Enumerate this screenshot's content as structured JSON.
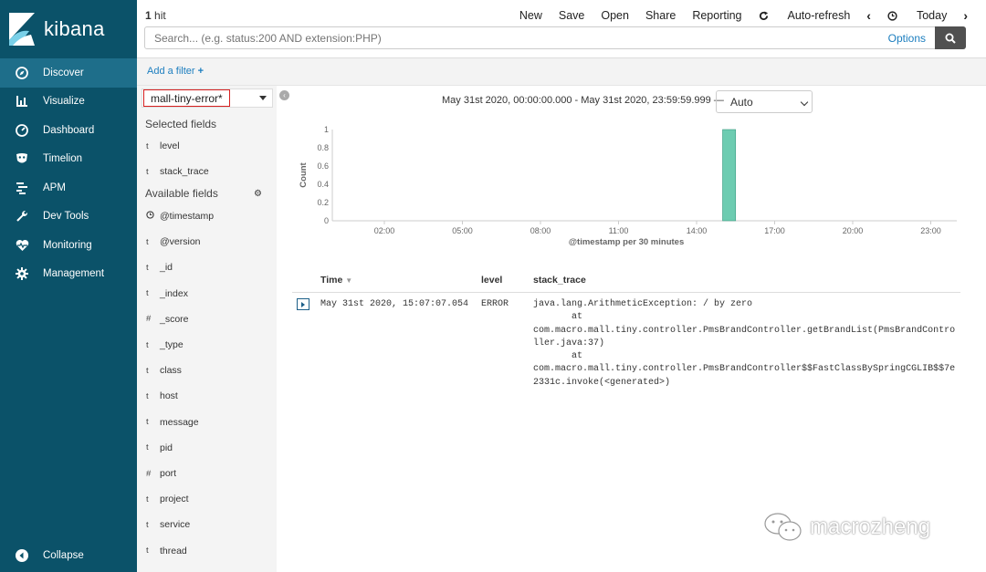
{
  "app": {
    "name": "kibana"
  },
  "sidebar": {
    "items": [
      {
        "label": "Discover",
        "icon": "compass-icon",
        "active": true
      },
      {
        "label": "Visualize",
        "icon": "bar-chart-icon"
      },
      {
        "label": "Dashboard",
        "icon": "dashboard-gauge-icon"
      },
      {
        "label": "Timelion",
        "icon": "timelion-mask-icon"
      },
      {
        "label": "APM",
        "icon": "apm-bars-icon"
      },
      {
        "label": "Dev Tools",
        "icon": "wrench-icon"
      },
      {
        "label": "Monitoring",
        "icon": "heartbeat-icon"
      },
      {
        "label": "Management",
        "icon": "gear-icon"
      }
    ],
    "collapse_label": "Collapse"
  },
  "topbar": {
    "hit_count": "1",
    "hit_label": "hit",
    "menu": {
      "new": "New",
      "save": "Save",
      "open": "Open",
      "share": "Share",
      "reporting": "Reporting",
      "auto_refresh": "Auto-refresh",
      "today": "Today"
    },
    "search_placeholder": "Search... (e.g. status:200 AND extension:PHP)",
    "options_label": "Options"
  },
  "filterbar": {
    "add_filter": "Add a filter"
  },
  "fields": {
    "index_pattern": "mall-tiny-error*",
    "selected_title": "Selected fields",
    "selected": [
      {
        "type": "t",
        "name": "level"
      },
      {
        "type": "t",
        "name": "stack_trace"
      }
    ],
    "available_title": "Available fields",
    "available": [
      {
        "type": "clock",
        "name": "@timestamp"
      },
      {
        "type": "t",
        "name": "@version"
      },
      {
        "type": "t",
        "name": "_id"
      },
      {
        "type": "t",
        "name": "_index"
      },
      {
        "type": "#",
        "name": "_score"
      },
      {
        "type": "t",
        "name": "_type"
      },
      {
        "type": "t",
        "name": "class"
      },
      {
        "type": "t",
        "name": "host"
      },
      {
        "type": "t",
        "name": "message"
      },
      {
        "type": "t",
        "name": "pid"
      },
      {
        "type": "#",
        "name": "port"
      },
      {
        "type": "t",
        "name": "project"
      },
      {
        "type": "t",
        "name": "service"
      },
      {
        "type": "t",
        "name": "thread"
      }
    ]
  },
  "main": {
    "time_range": "May 31st 2020, 00:00:00.000 - May 31st 2020, 23:59:59.999 —",
    "interval": "Auto"
  },
  "chart_data": {
    "type": "bar",
    "xlabel": "@timestamp per 30 minutes",
    "ylabel": "Count",
    "x_ticks": [
      "02:00",
      "05:00",
      "08:00",
      "11:00",
      "14:00",
      "17:00",
      "20:00",
      "23:00"
    ],
    "y_ticks": [
      "0",
      "0.2",
      "0.4",
      "0.6",
      "0.8",
      "1"
    ],
    "ylim": [
      0,
      1
    ],
    "x_range_hours": [
      0,
      24
    ],
    "bars": [
      {
        "start": "15:00",
        "end": "15:30",
        "count": 1
      }
    ],
    "bar_color": "#6dccb1"
  },
  "table": {
    "headers": {
      "time": "Time",
      "level": "level",
      "stack_trace": "stack_trace"
    },
    "rows": [
      {
        "time": "May 31st 2020, 15:07:07.054",
        "level": "ERROR",
        "stack_trace": "java.lang.ArithmeticException: / by zero\n       at\ncom.macro.mall.tiny.controller.PmsBrandController.getBrandList(PmsBrandContro\nller.java:37)\n       at\ncom.macro.mall.tiny.controller.PmsBrandController$$FastClassBySpringCGLIB$$7e\n2331c.invoke(<generated>)"
      }
    ]
  },
  "watermark": {
    "text": "macrozheng"
  }
}
